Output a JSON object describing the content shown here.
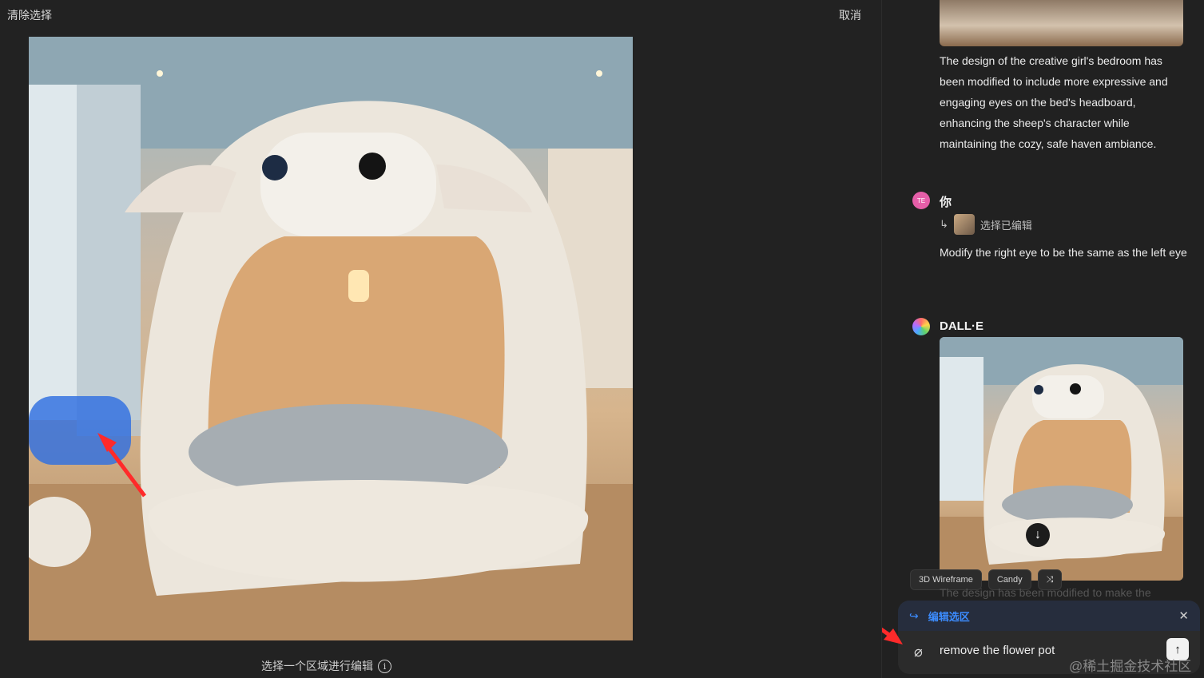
{
  "editor": {
    "clear_label": "清除选择",
    "cancel_label": "取消",
    "hint": "选择一个区域进行编辑"
  },
  "chat": {
    "prev_message": "The design of the creative girl's bedroom has been modified to include more expressive and engaging eyes on the bed's headboard, enhancing the sheep's character while maintaining the cozy, safe haven ambiance.",
    "user": {
      "avatar_initials": "TE",
      "name": "你",
      "reference_label": "选择已编辑",
      "message": "Modify the right eye to be the same as the left eye"
    },
    "assistant": {
      "name": "DALL·E",
      "chips": [
        "3D Wireframe",
        "Candy"
      ],
      "faded_text": "The design has been modified to make the"
    },
    "composer": {
      "selection_label": "编辑选区",
      "input_value": "remove the flower pot"
    }
  },
  "watermark": "@稀土掘金技术社区",
  "colors": {
    "accent_blue": "#3c8cff",
    "selection_mask": "#2f6fe0",
    "annotation_red": "#ff2a2a"
  }
}
